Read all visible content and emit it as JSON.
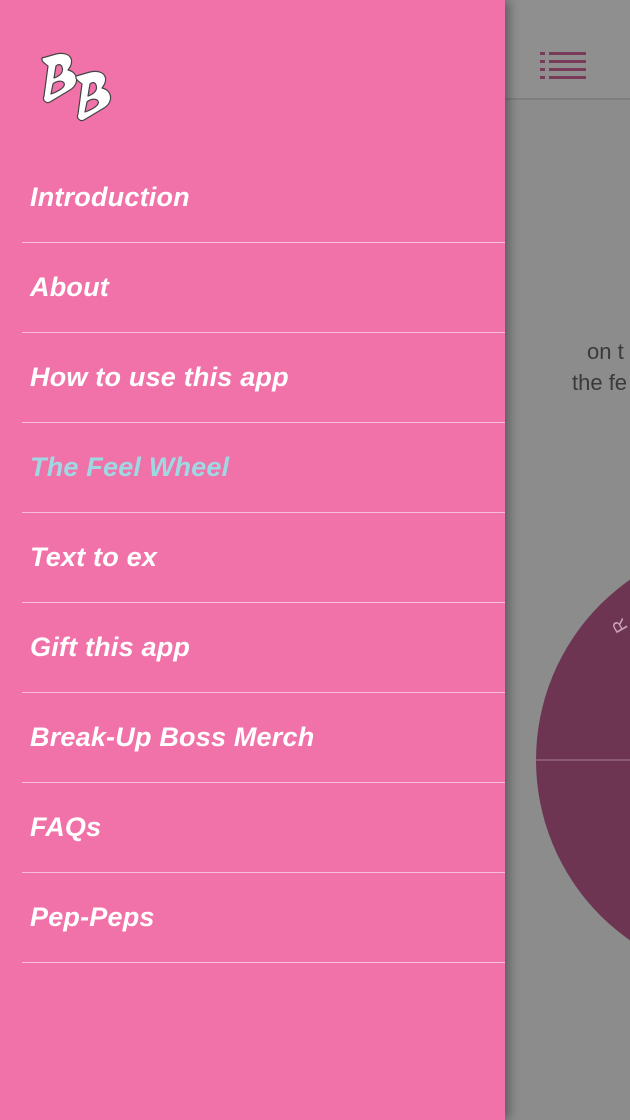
{
  "colors": {
    "drawer_bg": "#f172a9",
    "nav_text": "#ffffff",
    "nav_active_text": "#9ed9e3",
    "scrim_bg": "#8c8c8c",
    "wheel_color": "#6e3552"
  },
  "drawer": {
    "logo_icon": "bb-logo-icon",
    "items": [
      {
        "label": "Introduction",
        "active": false
      },
      {
        "label": "About",
        "active": false
      },
      {
        "label": "How to use this app",
        "active": false
      },
      {
        "label": "The Feel Wheel",
        "active": true
      },
      {
        "label": "Text to ex",
        "active": false
      },
      {
        "label": "Gift this app",
        "active": false
      },
      {
        "label": "Break-Up Boss Merch",
        "active": false
      },
      {
        "label": "FAQs",
        "active": false
      },
      {
        "label": "Pep-Peps",
        "active": false
      }
    ]
  },
  "main": {
    "menu_icon": "hamburger-menu-icon",
    "text_line1": "on t",
    "text_line2": "the fe",
    "wheel_label": "R"
  }
}
